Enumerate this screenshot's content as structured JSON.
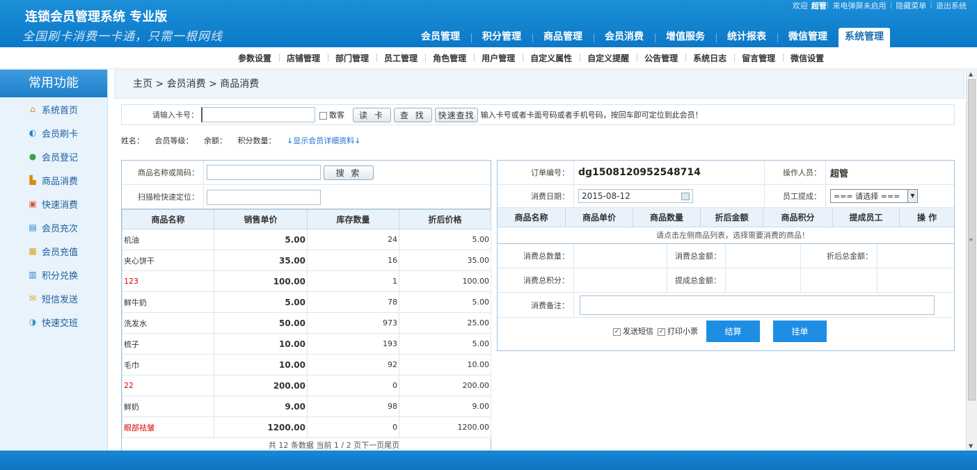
{
  "header": {
    "title": "连锁会员管理系统 专业版",
    "slogan": "全国刷卡消费一卡通，只需一根网线",
    "topbar": {
      "welcome": "欢迎",
      "user": "超管",
      "popup_status": "来电弹屏未启用",
      "hide_menu": "隐藏菜单",
      "logout": "退出系统"
    },
    "nav": [
      {
        "label": "会员管理"
      },
      {
        "label": "积分管理"
      },
      {
        "label": "商品管理"
      },
      {
        "label": "会员消费"
      },
      {
        "label": "增值服务"
      },
      {
        "label": "统计报表"
      },
      {
        "label": "微信管理"
      },
      {
        "label": "系统管理"
      }
    ],
    "subnav": [
      "参数设置",
      "店铺管理",
      "部门管理",
      "员工管理",
      "角色管理",
      "用户管理",
      "自定义属性",
      "自定义提醒",
      "公告管理",
      "系统日志",
      "留言管理",
      "微信设置"
    ]
  },
  "sidebar": {
    "title": "常用功能",
    "items": [
      {
        "label": "系统首页",
        "icon": "home-icon"
      },
      {
        "label": "会员刷卡",
        "icon": "member-card-icon"
      },
      {
        "label": "会员登记",
        "icon": "register-icon"
      },
      {
        "label": "商品消费",
        "icon": "cart-icon"
      },
      {
        "label": "快速消费",
        "icon": "quick-consume-icon"
      },
      {
        "label": "会员充次",
        "icon": "recharge-count-icon"
      },
      {
        "label": "会员充值",
        "icon": "recharge-icon"
      },
      {
        "label": "积分兑换",
        "icon": "points-exchange-icon"
      },
      {
        "label": "短信发送",
        "icon": "sms-icon"
      },
      {
        "label": "快速交班",
        "icon": "handover-icon"
      }
    ]
  },
  "breadcrumb": "主页 > 会员消费 > 商品消费",
  "card": {
    "label": "请输入卡号：",
    "value": "",
    "guest_label": "散客",
    "read_btn": "读 卡",
    "find_btn": "查 找",
    "quick_find_btn": "快速查找",
    "hint": "输入卡号或者卡面号码或者手机号码，按回车即可定位到此会员！"
  },
  "member_info": {
    "name_label": "姓名：",
    "level_label": "会员等级：",
    "balance_label": "余额：",
    "points_label": "积分数量：",
    "detail_link": "↓显示会员详细资料↓"
  },
  "product_search": {
    "name_label": "商品名称或简码：",
    "search_btn": "搜 索",
    "scan_label": "扫描枪快速定位："
  },
  "products": {
    "headers": [
      "商品名称",
      "销售单价",
      "库存数量",
      "折后价格"
    ],
    "rows": [
      {
        "name": "机油",
        "price": "5.00",
        "stock": "24",
        "discount": "5.00",
        "red": false
      },
      {
        "name": "夹心饼干",
        "price": "35.00",
        "stock": "16",
        "discount": "35.00",
        "red": false
      },
      {
        "name": "123",
        "price": "100.00",
        "stock": "1",
        "discount": "100.00",
        "red": true
      },
      {
        "name": "鲜牛奶",
        "price": "5.00",
        "stock": "78",
        "discount": "5.00",
        "red": false
      },
      {
        "name": "洗发水",
        "price": "50.00",
        "stock": "973",
        "discount": "25.00",
        "red": false
      },
      {
        "name": "梳子",
        "price": "10.00",
        "stock": "193",
        "discount": "5.00",
        "red": false
      },
      {
        "name": "毛巾",
        "price": "10.00",
        "stock": "92",
        "discount": "10.00",
        "red": false
      },
      {
        "name": "22",
        "price": "200.00",
        "stock": "0",
        "discount": "200.00",
        "red": true
      },
      {
        "name": "鲜奶",
        "price": "9.00",
        "stock": "98",
        "discount": "9.00",
        "red": false
      },
      {
        "name": "眼部祛皱",
        "price": "1200.00",
        "stock": "0",
        "discount": "1200.00",
        "red": true
      }
    ],
    "pager": "共 12 条数据 当前 1 / 2 页下一页尾页"
  },
  "order": {
    "no_label": "订单编号：",
    "no": "dg1508120952548714",
    "operator_label": "操作人员：",
    "operator": "超管",
    "date_label": "消费日期：",
    "date": "2015-08-12",
    "staff_label": "员工提成：",
    "staff_select": "=== 请选择 ===",
    "headers": [
      "商品名称",
      "商品单价",
      "商品数量",
      "折后金额",
      "商品积分",
      "提成员工",
      "操 作"
    ],
    "empty_msg": "请点击左侧商品列表，选择需要消费的商品！",
    "total_qty_label": "消费总数量：",
    "total_amount_label": "消费总金额：",
    "discount_total_label": "折后总金额：",
    "total_points_label": "消费总积分：",
    "commission_total_label": "提成总金额：",
    "notes_label": "消费备注：",
    "send_sms": "发送短信",
    "print_receipt": "打印小票",
    "settle_btn": "结算",
    "hold_btn": "挂单"
  }
}
